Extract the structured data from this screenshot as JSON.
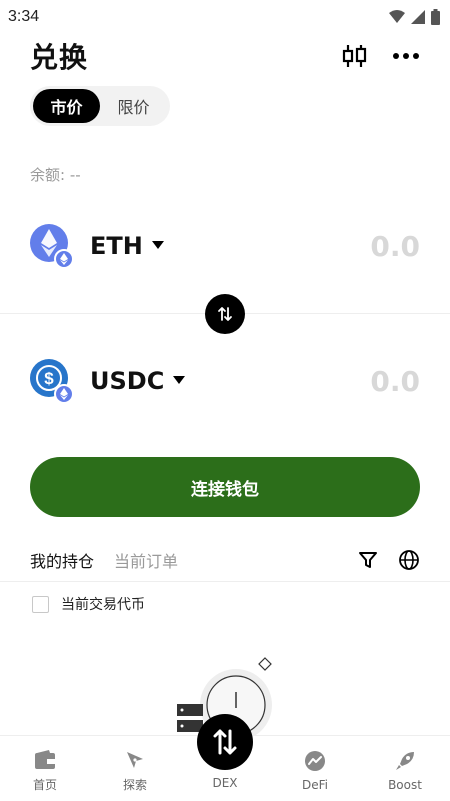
{
  "status": {
    "time": "3:34"
  },
  "header": {
    "title": "兑换"
  },
  "order_type": {
    "tabs": [
      "市价",
      "限价"
    ],
    "active": "市价"
  },
  "balance": {
    "label": "余额: --"
  },
  "from_token": {
    "symbol": "ETH",
    "amount": "0.0",
    "icon": "ethereum-icon",
    "color": "#627eea"
  },
  "to_token": {
    "symbol": "USDC",
    "amount": "0.0",
    "icon": "usdc-icon",
    "color": "#2775ca"
  },
  "connect_button": {
    "label": "连接钱包",
    "color": "#2c6e1a"
  },
  "holdings": {
    "tabs": [
      "我的持仓",
      "当前订单"
    ],
    "active": "我的持仓",
    "filter_label": "当前交易代币"
  },
  "bottom_nav": {
    "items": [
      {
        "label": "首页",
        "icon": "wallet-icon"
      },
      {
        "label": "探索",
        "icon": "compass-icon"
      },
      {
        "label": "DEX",
        "icon": "swap-icon"
      },
      {
        "label": "DeFi",
        "icon": "chart-icon"
      },
      {
        "label": "Boost",
        "icon": "rocket-icon"
      }
    ],
    "active": "DEX"
  }
}
